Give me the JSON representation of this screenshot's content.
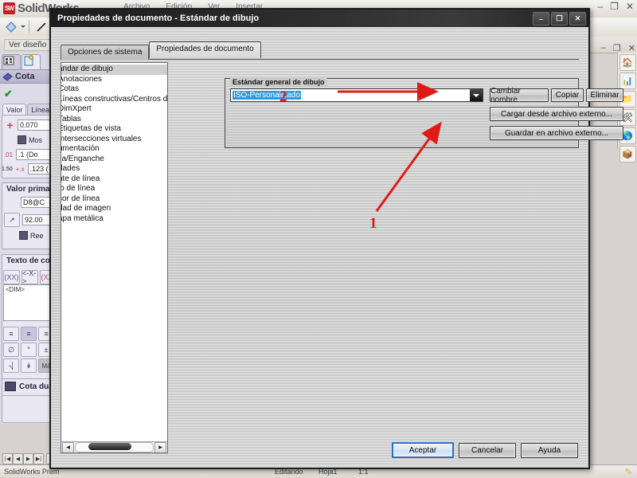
{
  "app": {
    "name": "SolidWorks",
    "logo_mark": "SW",
    "menu_items": [
      "Archivo",
      "Edición",
      "Ver",
      "Insertar"
    ],
    "window_controls": [
      "minimize",
      "restore",
      "close"
    ],
    "subbar_label": "Ver diseño",
    "doc_window_controls": [
      "minimize",
      "restore",
      "close"
    ],
    "status": {
      "left": "SolidWorks Prem",
      "items": [
        "Editando",
        "Hoja1",
        "1:1"
      ],
      "pencil_icon": "pencil-icon"
    },
    "sheet_tabs": {
      "nav": [
        "first",
        "prev",
        "next",
        "last"
      ],
      "tabs": [
        "Hoja1"
      ]
    },
    "right_dock_icons": [
      "home-icon",
      "chart-icon",
      "folder-icon",
      "design-library-icon",
      "globe-icon",
      "appearances-icon"
    ],
    "toolbar_icons": [
      "sketch-icon",
      "line-icon",
      "smart-dimension-icon",
      "trim-icon",
      "offset-icon"
    ]
  },
  "property_manager": {
    "tabs": [
      "feature-manager-tab",
      "property-manager-tab"
    ],
    "title": "Cota",
    "title_icon": "dimension-icon",
    "accept_icon": "green-check-icon",
    "subtabs": [
      "Valor",
      "Líneas"
    ],
    "value_section": {
      "tolerance_icon": "plus-icon",
      "dimension_value": "0.070",
      "show_checkbox_label": "Mos",
      "precision_icon_1": "precision-icon",
      "precision_value_1": ".1 (Do",
      "precision_icon_2": "tolerance-precision-icon",
      "precision_value_2": ".123 (",
      "precision_prefix_2": "1.50"
    },
    "primary_value_section": {
      "title": "Valor primar",
      "name_value": "D8@C",
      "arrow_icon": "link-icon",
      "numeric_value": "92.00",
      "override_checkbox_label": "Ree"
    },
    "dimension_text_section": {
      "title": "Texto de cot",
      "buttons": [
        "(XX)",
        "<-X->",
        "(XX)"
      ],
      "textarea_value": "<DIM>"
    },
    "align_buttons": [
      "align-left-icon",
      "align-center-icon",
      "align-right-icon"
    ],
    "symbol_buttons_row1": [
      "diameter-icon",
      "degree-icon",
      "plus-minus-icon"
    ],
    "symbol_buttons_row2": [
      "counterbore-icon",
      "depth-icon",
      "Má"
    ],
    "dual_dimension": {
      "icon": "dual-dimension-icon",
      "label": "Cota dua"
    }
  },
  "dialog": {
    "title": "Propiedades de documento - Estándar de dibujo",
    "window_controls": {
      "minimize": "–",
      "restore": "❐",
      "close": "✕"
    },
    "tabs": [
      {
        "label": "Opciones de sistema",
        "active": false
      },
      {
        "label": "Propiedades de documento",
        "active": true
      }
    ],
    "tree_items": [
      {
        "label": "ándar de dibujo",
        "selected": true
      },
      {
        "label": "Anotaciones",
        "selected": false
      },
      {
        "label": "Cotas",
        "selected": false
      },
      {
        "label": "Líneas constructivas/Centros de",
        "selected": false
      },
      {
        "label": "DimXpert",
        "selected": false
      },
      {
        "label": "Tablas",
        "selected": false
      },
      {
        "label": "Etiquetas de vista",
        "selected": false
      },
      {
        "label": "Intersecciones virtuales",
        "selected": false
      },
      {
        "label": "umentación",
        "selected": false
      },
      {
        "label": "lla/Enganche",
        "selected": false
      },
      {
        "label": "dades",
        "selected": false
      },
      {
        "label": "nte de línea",
        "selected": false
      },
      {
        "label": "lo de línea",
        "selected": false
      },
      {
        "label": "sor de línea",
        "selected": false
      },
      {
        "label": "dad de imagen",
        "selected": false
      },
      {
        "label": "apa metálica",
        "selected": false
      }
    ],
    "group": {
      "title": "Estándar general de dibujo",
      "combo_value": "ISO-Personalizado",
      "combo_dropdown_icon": "chevron-down-icon",
      "buttons": {
        "rename": "Cambiar nombre",
        "copy": "Copiar",
        "delete": "Eliminar",
        "load_external": "Cargar desde archivo externo...",
        "save_external": "Guardar en archivo externo..."
      }
    },
    "footer_buttons": {
      "ok": "Aceptar",
      "cancel": "Cancelar",
      "help": "Ayuda"
    }
  },
  "annotations": {
    "color": "#e01b16",
    "markers": [
      {
        "label": "1",
        "target": "save-external-button"
      },
      {
        "label": "2",
        "target": "load-external-button"
      }
    ]
  }
}
